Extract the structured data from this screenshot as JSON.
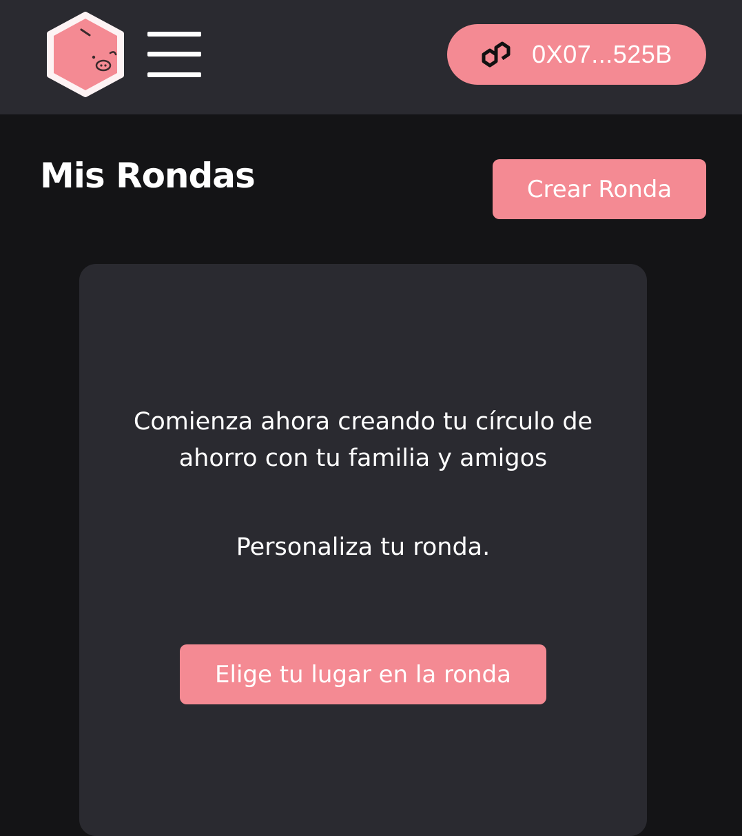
{
  "colors": {
    "accent": "#f48a93",
    "header_bg": "#2a2a30",
    "page_bg": "#141416",
    "card_bg": "#2a2a30",
    "text": "#ffffff"
  },
  "header": {
    "logo_icon": "pig-hexagon-logo",
    "menu_icon": "hamburger-menu-icon",
    "wallet": {
      "icon": "polygon-icon",
      "address": "0X07...525B"
    }
  },
  "main": {
    "title": "Mis Rondas",
    "create_button": "Crear Ronda",
    "card": {
      "message": "Comienza ahora creando tu círculo de ahorro con tu familia y amigos",
      "subtitle": "Personaliza tu ronda.",
      "cta_button": "Elige tu lugar en la ronda"
    }
  }
}
